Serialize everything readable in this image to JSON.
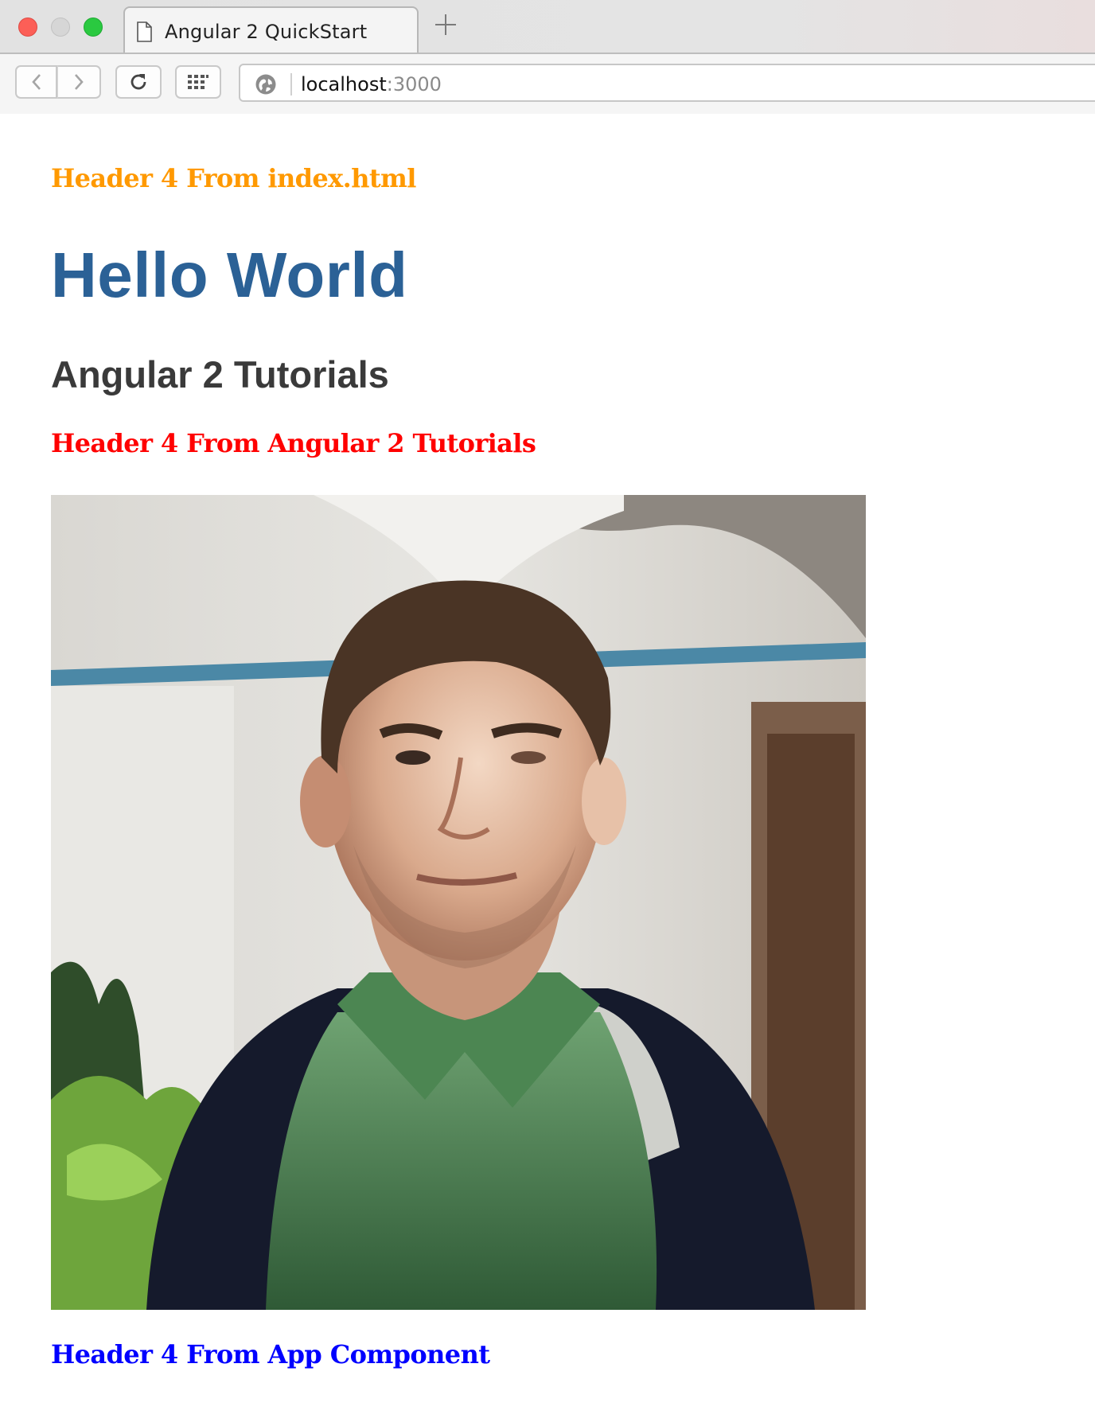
{
  "browser": {
    "tab": {
      "title": "Angular 2 QuickStart",
      "icon": "document-icon"
    },
    "new_tab_icon": "plus-icon",
    "toolbar": {
      "back_icon": "chevron-left-icon",
      "forward_icon": "chevron-right-icon",
      "reload_icon": "reload-icon",
      "apps_icon": "apps-grid-icon",
      "site_info_icon": "globe-icon"
    },
    "address": {
      "host": "localhost",
      "port": ":3000"
    }
  },
  "page": {
    "header_index": "Header 4 From index.html",
    "title": "Hello World",
    "subtitle": "Angular 2 Tutorials",
    "header_angular": "Header 4 From Angular 2 Tutorials",
    "photo": "portrait-photo",
    "header_app": "Header 4 From App Component"
  },
  "colors": {
    "header_index": "#ff9900",
    "title": "#2b6196",
    "subtitle": "#3a3a3a",
    "header_angular": "#ff0000",
    "header_app": "#0000ff"
  }
}
